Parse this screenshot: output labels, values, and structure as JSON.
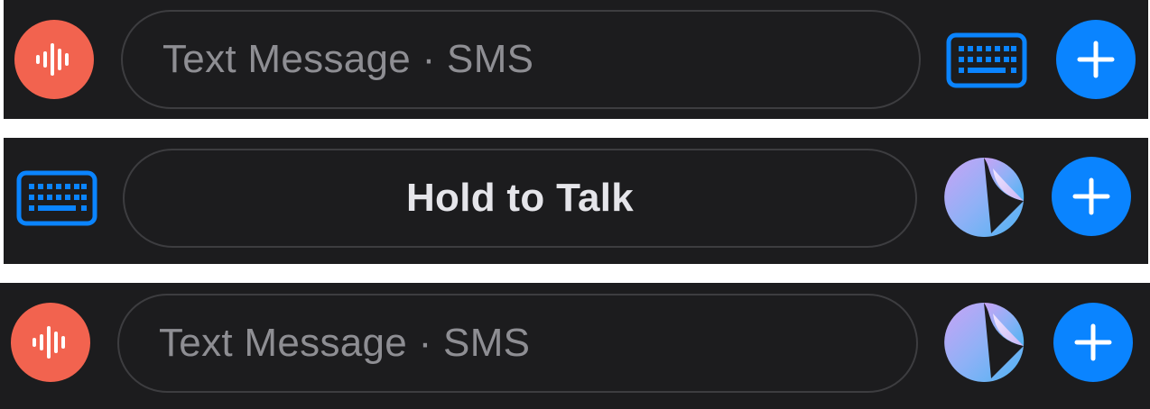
{
  "bars": [
    {
      "left_button": {
        "icon": "waveform-icon",
        "color": "#f2634f"
      },
      "input": {
        "placeholder": "Text Message · SMS"
      },
      "right_buttons": [
        {
          "icon": "keyboard-icon",
          "color": "#0a84ff"
        },
        {
          "icon": "plus-icon",
          "color": "#0a84ff"
        }
      ]
    },
    {
      "left_button": {
        "icon": "keyboard-icon",
        "color": "#0a84ff"
      },
      "hold_button": {
        "label": "Hold to Talk"
      },
      "right_buttons": [
        {
          "icon": "sticker-icon"
        },
        {
          "icon": "plus-icon",
          "color": "#0a84ff"
        }
      ]
    },
    {
      "left_button": {
        "icon": "waveform-icon",
        "color": "#f2634f"
      },
      "input": {
        "placeholder": "Text Message · SMS"
      },
      "right_buttons": [
        {
          "icon": "sticker-icon"
        },
        {
          "icon": "plus-icon",
          "color": "#0a84ff"
        }
      ]
    }
  ]
}
